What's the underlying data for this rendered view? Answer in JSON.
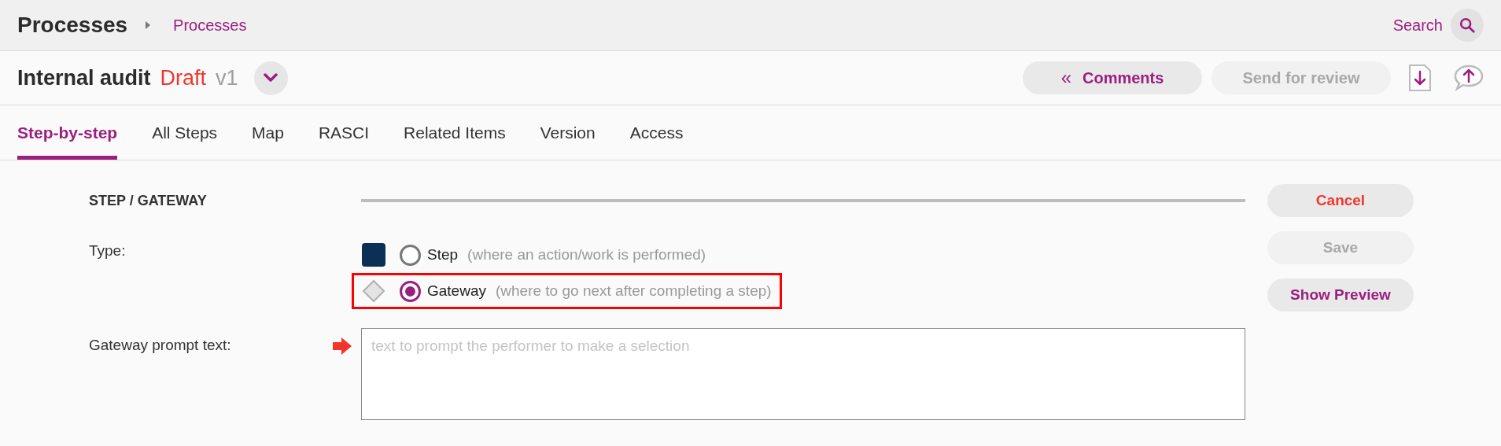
{
  "header": {
    "title": "Processes",
    "breadcrumb": "Processes",
    "search_label": "Search"
  },
  "document": {
    "title": "Internal audit",
    "status": "Draft",
    "version": "v1"
  },
  "toolbar": [
    {
      "label": "Comments",
      "icon": "«",
      "disabled": false
    },
    {
      "label": "Send for review",
      "disabled": true
    }
  ],
  "tabs": [
    {
      "label": "Step-by-step",
      "selected": true
    },
    {
      "label": "All Steps",
      "selected": false
    },
    {
      "label": "Map",
      "selected": false
    },
    {
      "label": "RASCI",
      "selected": false
    },
    {
      "label": "Related Items",
      "selected": false
    },
    {
      "label": "Version",
      "selected": false
    },
    {
      "label": "Access",
      "selected": false
    }
  ],
  "section": {
    "title": "STEP / GATEWAY"
  },
  "type_field": {
    "label": "Type:",
    "options": [
      {
        "kind": "step",
        "label": "Step",
        "hint": "(where an action/work is performed)",
        "selected": false,
        "highlighted": false
      },
      {
        "kind": "gateway",
        "label": "Gateway",
        "hint": "(where to go next after completing a step)",
        "selected": true,
        "highlighted": true
      }
    ]
  },
  "prompt_field": {
    "label": "Gateway prompt text:",
    "placeholder": "text to prompt the performer to make a selection",
    "flagged": true
  },
  "actions": [
    {
      "kind": "danger",
      "label": "Cancel",
      "disabled": false
    },
    {
      "kind": "primary",
      "label": "Save",
      "disabled": true
    },
    {
      "kind": "primary",
      "label": "Show Preview",
      "disabled": false
    }
  ]
}
